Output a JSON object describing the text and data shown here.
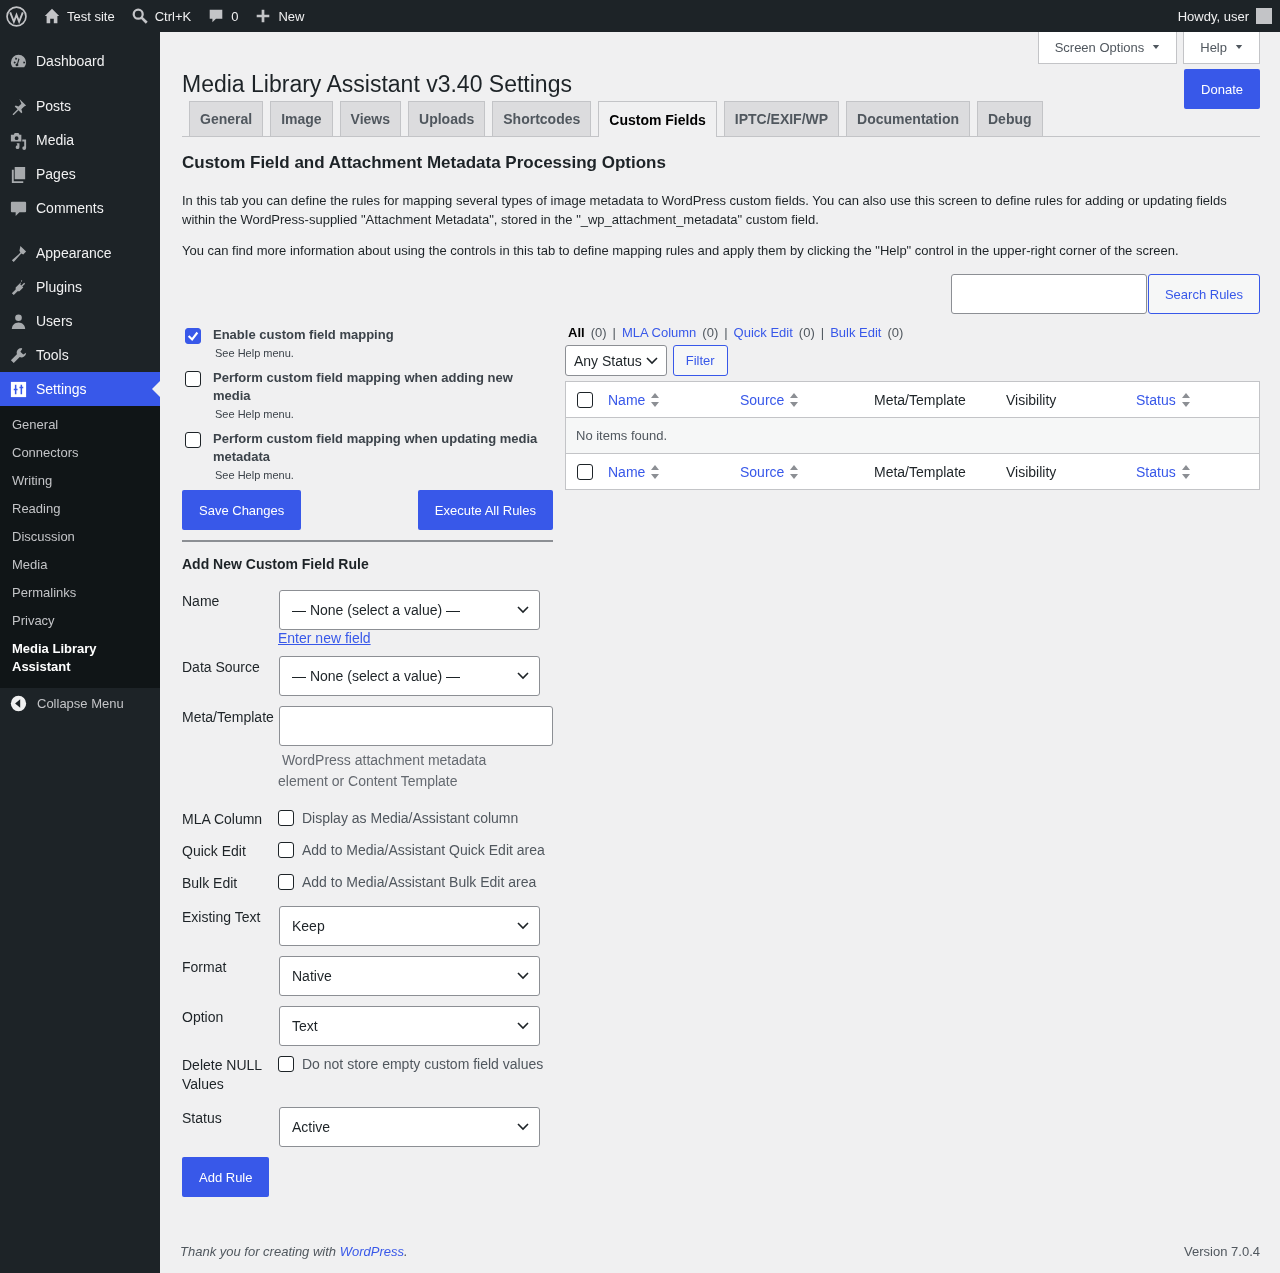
{
  "admin_bar": {
    "site": "Test site",
    "search": "Ctrl+K",
    "comments": "0",
    "new": "New",
    "greeting": "Howdy, user"
  },
  "sidebar": {
    "items": [
      {
        "label": "Dashboard",
        "selected": false
      },
      {
        "label": "Posts",
        "selected": false
      },
      {
        "label": "Media",
        "selected": false
      },
      {
        "label": "Pages",
        "selected": false
      },
      {
        "label": "Comments",
        "selected": false
      },
      {
        "label": "Appearance",
        "selected": false
      },
      {
        "label": "Plugins",
        "selected": false
      },
      {
        "label": "Users",
        "selected": false
      },
      {
        "label": "Tools",
        "selected": false
      },
      {
        "label": "Settings",
        "selected": true
      }
    ],
    "submenu": [
      {
        "label": "General",
        "selected": false
      },
      {
        "label": "Connectors",
        "selected": false
      },
      {
        "label": "Writing",
        "selected": false
      },
      {
        "label": "Reading",
        "selected": false
      },
      {
        "label": "Discussion",
        "selected": false
      },
      {
        "label": "Media",
        "selected": false
      },
      {
        "label": "Permalinks",
        "selected": false
      },
      {
        "label": "Privacy",
        "selected": false
      },
      {
        "label": "Media Library Assistant",
        "selected": true
      }
    ],
    "collapse": "Collapse Menu"
  },
  "screen_options": "Screen Options",
  "help": "Help",
  "donate": "Donate",
  "title": "Media Library Assistant v3.40 Settings",
  "tabs": [
    {
      "label": "General",
      "selected": false
    },
    {
      "label": "Image",
      "selected": false
    },
    {
      "label": "Views",
      "selected": false
    },
    {
      "label": "Uploads",
      "selected": false
    },
    {
      "label": "Shortcodes",
      "selected": false
    },
    {
      "label": "Custom Fields",
      "selected": true
    },
    {
      "label": "IPTC/EXIF/WP",
      "selected": false
    },
    {
      "label": "Documentation",
      "selected": false
    },
    {
      "label": "Debug",
      "selected": false
    }
  ],
  "heading": "Custom Field and Attachment Metadata Processing Options",
  "intro": [
    "In this tab you can define the rules for mapping several types of image metadata to WordPress custom fields. You can also use this screen to define rules for adding or updating fields within the WordPress-supplied \"Attachment Metadata\", stored in the \"_wp_attachment_metadata\" custom field.",
    "You can find more information about using the controls in this tab to define mapping rules and apply them by clicking the \"Help\" control in the upper-right corner of the screen."
  ],
  "search_button": "Search Rules",
  "options": [
    {
      "label": "Enable custom field mapping",
      "hint": "See Help menu.",
      "checked": true
    },
    {
      "label": "Perform custom field mapping when adding new media",
      "hint": "See Help menu.",
      "checked": false
    },
    {
      "label": "Perform custom field mapping when updating media metadata",
      "hint": "See Help menu.",
      "checked": false
    }
  ],
  "save": "Save Changes",
  "execute": "Execute All Rules",
  "rule_form": {
    "title": "Add New Custom Field Rule",
    "fields": [
      {
        "kind": "select",
        "label": "Name",
        "value": "— None (select a value) —",
        "link": "Enter new field"
      },
      {
        "kind": "select",
        "label": "Data Source",
        "value": "— None (select a value) —"
      },
      {
        "kind": "text",
        "label": "Meta/Template",
        "hint": "WordPress attachment metadata element or Content Template"
      },
      {
        "kind": "checkbox",
        "label": "MLA Column",
        "text": "Display as Media/Assistant column",
        "checked": false
      },
      {
        "kind": "checkbox",
        "label": "Quick Edit",
        "text": "Add to Media/Assistant Quick Edit area",
        "checked": false
      },
      {
        "kind": "checkbox",
        "label": "Bulk Edit",
        "text": "Add to Media/Assistant Bulk Edit area",
        "checked": false
      },
      {
        "kind": "select",
        "label": "Existing Text",
        "value": "Keep"
      },
      {
        "kind": "select",
        "label": "Format",
        "value": "Native"
      },
      {
        "kind": "select",
        "label": "Option",
        "value": "Text"
      },
      {
        "kind": "checkbox",
        "label": "Delete NULL Values",
        "text": "Do not store empty custom field values",
        "checked": false
      },
      {
        "kind": "select",
        "label": "Status",
        "value": "Active"
      }
    ],
    "submit": "Add Rule"
  },
  "views": [
    {
      "label": "All",
      "count": "(0)",
      "selected": true
    },
    {
      "separator": "|",
      "label": "MLA Column",
      "count": "(0)",
      "selected": false
    },
    {
      "separator": "|",
      "label": "Quick Edit",
      "count": "(0)",
      "selected": false
    },
    {
      "separator": "|",
      "label": "Bulk Edit",
      "count": "(0)",
      "selected": false
    }
  ],
  "status_filter": "Any Status",
  "filter": "Filter",
  "table": {
    "header": {
      "checked": false,
      "columns": [
        {
          "label": "Name",
          "sortable": true
        },
        {
          "label": "Source",
          "sortable": true
        },
        {
          "label": "Meta/Template",
          "sortable": false
        },
        {
          "label": "Visibility",
          "sortable": false
        },
        {
          "label": "Status",
          "sortable": true
        }
      ]
    },
    "empty": "No items found.",
    "footer": {
      "checked": false,
      "columns": [
        {
          "label": "Name",
          "sortable": true
        },
        {
          "label": "Source",
          "sortable": true
        },
        {
          "label": "Meta/Template",
          "sortable": false
        },
        {
          "label": "Visibility",
          "sortable": false
        },
        {
          "label": "Status",
          "sortable": true
        }
      ]
    }
  },
  "footer": {
    "thanks": "Thank you for creating with",
    "link": "WordPress",
    "end": ".",
    "version": "Version 7.0.4"
  }
}
